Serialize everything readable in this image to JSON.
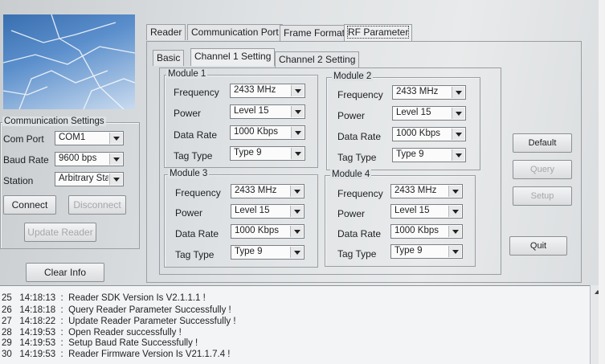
{
  "tabs": [
    "Reader",
    "Communication Port",
    "Frame Format",
    "RF Parameter"
  ],
  "subtabs": [
    "Basic",
    "Channel 1 Setting",
    "Channel 2 Setting"
  ],
  "module_labels": {
    "frequency": "Frequency",
    "power": "Power",
    "data_rate": "Data Rate",
    "tag_type": "Tag Type"
  },
  "modules": [
    {
      "title": "Module 1",
      "frequency": "2433 MHz",
      "power": "Level 15",
      "data_rate": "1000 Kbps",
      "tag_type": "Type 9"
    },
    {
      "title": "Module 2",
      "frequency": "2433 MHz",
      "power": "Level 15",
      "data_rate": "1000 Kbps",
      "tag_type": "Type 9"
    },
    {
      "title": "Module 3",
      "frequency": "2433 MHz",
      "power": "Level 15",
      "data_rate": "1000 Kbps",
      "tag_type": "Type 9"
    },
    {
      "title": "Module 4",
      "frequency": "2433 MHz",
      "power": "Level 15",
      "data_rate": "1000 Kbps",
      "tag_type": "Type 9"
    }
  ],
  "comm": {
    "title": "Communication Settings",
    "com_port_label": "Com Port",
    "com_port": "COM1",
    "baud_rate_label": "Baud Rate",
    "baud_rate": "9600  bps",
    "station_label": "Station",
    "station": "Arbitrary Sta",
    "connect": "Connect",
    "disconnect": "Disconnect",
    "update_reader": "Update Reader"
  },
  "clear_info": "Clear Info",
  "side_buttons": {
    "default": "Default",
    "query": "Query",
    "setup": "Setup",
    "quit": "Quit"
  },
  "log": [
    {
      "n": "25",
      "time": "14:18:13",
      "msg": "Reader SDK Version Is V2.1.1.1 !"
    },
    {
      "n": "26",
      "time": "14:18:18",
      "msg": "Query Reader Parameter Successfully !"
    },
    {
      "n": "27",
      "time": "14:18:22",
      "msg": "Update Reader Parameter Successfully !"
    },
    {
      "n": "28",
      "time": "14:19:53",
      "msg": "Open Reader successfully !"
    },
    {
      "n": "29",
      "time": "14:19:53",
      "msg": "Setup Baud Rate Successfully !"
    },
    {
      "n": "30",
      "time": "14:19:53",
      "msg": "Reader Firmware Version Is V21.1.7.4 !"
    }
  ]
}
